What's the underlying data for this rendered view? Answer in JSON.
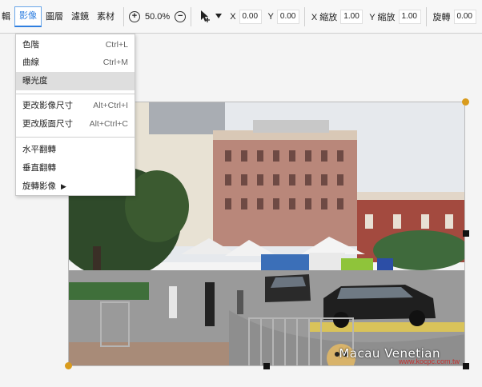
{
  "menubar": {
    "items": [
      {
        "label": "輯"
      },
      {
        "label": "影像"
      },
      {
        "label": "圖層"
      },
      {
        "label": "濾鏡"
      },
      {
        "label": "素材"
      }
    ]
  },
  "zoom": {
    "in_icon": "+",
    "out_icon": "−",
    "value": "50.0%"
  },
  "position": {
    "x_label": "X",
    "x_value": "0.00",
    "y_label": "Y",
    "y_value": "0.00"
  },
  "scale": {
    "x_label": "X 縮放",
    "x_value": "1.00",
    "y_label": "Y 縮放",
    "y_value": "1.00"
  },
  "rotate": {
    "label": "旋轉",
    "value": "0.00"
  },
  "image_menu": {
    "items": [
      {
        "label": "色階",
        "shortcut": "Ctrl+L"
      },
      {
        "label": "曲線",
        "shortcut": "Ctrl+M"
      },
      {
        "label": "曝光度",
        "shortcut": ""
      },
      {
        "label": "更改影像尺寸",
        "shortcut": "Alt+Ctrl+I"
      },
      {
        "label": "更改版面尺寸",
        "shortcut": "Alt+Ctrl+C"
      },
      {
        "label": "水平翻轉",
        "shortcut": ""
      },
      {
        "label": "垂直翻轉",
        "shortcut": ""
      },
      {
        "label": "旋轉影像",
        "shortcut": "",
        "arrow": "▶"
      }
    ]
  },
  "photo": {
    "watermark": "Macau Venetian",
    "site_url": "www.kocpc.com.tw"
  }
}
